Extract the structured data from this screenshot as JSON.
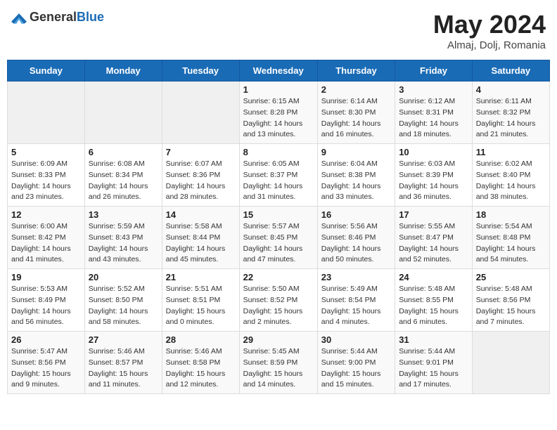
{
  "header": {
    "logo": {
      "general": "General",
      "blue": "Blue"
    },
    "title": "May 2024",
    "location": "Almaj, Dolj, Romania"
  },
  "weekdays": [
    "Sunday",
    "Monday",
    "Tuesday",
    "Wednesday",
    "Thursday",
    "Friday",
    "Saturday"
  ],
  "weeks": [
    [
      {
        "day": "",
        "sunrise": "",
        "sunset": "",
        "daylight": ""
      },
      {
        "day": "",
        "sunrise": "",
        "sunset": "",
        "daylight": ""
      },
      {
        "day": "",
        "sunrise": "",
        "sunset": "",
        "daylight": ""
      },
      {
        "day": "1",
        "sunrise": "Sunrise: 6:15 AM",
        "sunset": "Sunset: 8:28 PM",
        "daylight": "Daylight: 14 hours and 13 minutes."
      },
      {
        "day": "2",
        "sunrise": "Sunrise: 6:14 AM",
        "sunset": "Sunset: 8:30 PM",
        "daylight": "Daylight: 14 hours and 16 minutes."
      },
      {
        "day": "3",
        "sunrise": "Sunrise: 6:12 AM",
        "sunset": "Sunset: 8:31 PM",
        "daylight": "Daylight: 14 hours and 18 minutes."
      },
      {
        "day": "4",
        "sunrise": "Sunrise: 6:11 AM",
        "sunset": "Sunset: 8:32 PM",
        "daylight": "Daylight: 14 hours and 21 minutes."
      }
    ],
    [
      {
        "day": "5",
        "sunrise": "Sunrise: 6:09 AM",
        "sunset": "Sunset: 8:33 PM",
        "daylight": "Daylight: 14 hours and 23 minutes."
      },
      {
        "day": "6",
        "sunrise": "Sunrise: 6:08 AM",
        "sunset": "Sunset: 8:34 PM",
        "daylight": "Daylight: 14 hours and 26 minutes."
      },
      {
        "day": "7",
        "sunrise": "Sunrise: 6:07 AM",
        "sunset": "Sunset: 8:36 PM",
        "daylight": "Daylight: 14 hours and 28 minutes."
      },
      {
        "day": "8",
        "sunrise": "Sunrise: 6:05 AM",
        "sunset": "Sunset: 8:37 PM",
        "daylight": "Daylight: 14 hours and 31 minutes."
      },
      {
        "day": "9",
        "sunrise": "Sunrise: 6:04 AM",
        "sunset": "Sunset: 8:38 PM",
        "daylight": "Daylight: 14 hours and 33 minutes."
      },
      {
        "day": "10",
        "sunrise": "Sunrise: 6:03 AM",
        "sunset": "Sunset: 8:39 PM",
        "daylight": "Daylight: 14 hours and 36 minutes."
      },
      {
        "day": "11",
        "sunrise": "Sunrise: 6:02 AM",
        "sunset": "Sunset: 8:40 PM",
        "daylight": "Daylight: 14 hours and 38 minutes."
      }
    ],
    [
      {
        "day": "12",
        "sunrise": "Sunrise: 6:00 AM",
        "sunset": "Sunset: 8:42 PM",
        "daylight": "Daylight: 14 hours and 41 minutes."
      },
      {
        "day": "13",
        "sunrise": "Sunrise: 5:59 AM",
        "sunset": "Sunset: 8:43 PM",
        "daylight": "Daylight: 14 hours and 43 minutes."
      },
      {
        "day": "14",
        "sunrise": "Sunrise: 5:58 AM",
        "sunset": "Sunset: 8:44 PM",
        "daylight": "Daylight: 14 hours and 45 minutes."
      },
      {
        "day": "15",
        "sunrise": "Sunrise: 5:57 AM",
        "sunset": "Sunset: 8:45 PM",
        "daylight": "Daylight: 14 hours and 47 minutes."
      },
      {
        "day": "16",
        "sunrise": "Sunrise: 5:56 AM",
        "sunset": "Sunset: 8:46 PM",
        "daylight": "Daylight: 14 hours and 50 minutes."
      },
      {
        "day": "17",
        "sunrise": "Sunrise: 5:55 AM",
        "sunset": "Sunset: 8:47 PM",
        "daylight": "Daylight: 14 hours and 52 minutes."
      },
      {
        "day": "18",
        "sunrise": "Sunrise: 5:54 AM",
        "sunset": "Sunset: 8:48 PM",
        "daylight": "Daylight: 14 hours and 54 minutes."
      }
    ],
    [
      {
        "day": "19",
        "sunrise": "Sunrise: 5:53 AM",
        "sunset": "Sunset: 8:49 PM",
        "daylight": "Daylight: 14 hours and 56 minutes."
      },
      {
        "day": "20",
        "sunrise": "Sunrise: 5:52 AM",
        "sunset": "Sunset: 8:50 PM",
        "daylight": "Daylight: 14 hours and 58 minutes."
      },
      {
        "day": "21",
        "sunrise": "Sunrise: 5:51 AM",
        "sunset": "Sunset: 8:51 PM",
        "daylight": "Daylight: 15 hours and 0 minutes."
      },
      {
        "day": "22",
        "sunrise": "Sunrise: 5:50 AM",
        "sunset": "Sunset: 8:52 PM",
        "daylight": "Daylight: 15 hours and 2 minutes."
      },
      {
        "day": "23",
        "sunrise": "Sunrise: 5:49 AM",
        "sunset": "Sunset: 8:54 PM",
        "daylight": "Daylight: 15 hours and 4 minutes."
      },
      {
        "day": "24",
        "sunrise": "Sunrise: 5:48 AM",
        "sunset": "Sunset: 8:55 PM",
        "daylight": "Daylight: 15 hours and 6 minutes."
      },
      {
        "day": "25",
        "sunrise": "Sunrise: 5:48 AM",
        "sunset": "Sunset: 8:56 PM",
        "daylight": "Daylight: 15 hours and 7 minutes."
      }
    ],
    [
      {
        "day": "26",
        "sunrise": "Sunrise: 5:47 AM",
        "sunset": "Sunset: 8:56 PM",
        "daylight": "Daylight: 15 hours and 9 minutes."
      },
      {
        "day": "27",
        "sunrise": "Sunrise: 5:46 AM",
        "sunset": "Sunset: 8:57 PM",
        "daylight": "Daylight: 15 hours and 11 minutes."
      },
      {
        "day": "28",
        "sunrise": "Sunrise: 5:46 AM",
        "sunset": "Sunset: 8:58 PM",
        "daylight": "Daylight: 15 hours and 12 minutes."
      },
      {
        "day": "29",
        "sunrise": "Sunrise: 5:45 AM",
        "sunset": "Sunset: 8:59 PM",
        "daylight": "Daylight: 15 hours and 14 minutes."
      },
      {
        "day": "30",
        "sunrise": "Sunrise: 5:44 AM",
        "sunset": "Sunset: 9:00 PM",
        "daylight": "Daylight: 15 hours and 15 minutes."
      },
      {
        "day": "31",
        "sunrise": "Sunrise: 5:44 AM",
        "sunset": "Sunset: 9:01 PM",
        "daylight": "Daylight: 15 hours and 17 minutes."
      },
      {
        "day": "",
        "sunrise": "",
        "sunset": "",
        "daylight": ""
      }
    ]
  ]
}
